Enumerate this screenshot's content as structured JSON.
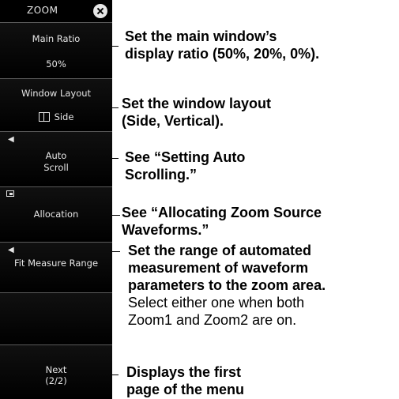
{
  "menu": {
    "title": "ZOOM",
    "main_ratio": {
      "label": "Main Ratio",
      "value": "50%"
    },
    "window_layout": {
      "label": "Window Layout",
      "value": "Side"
    },
    "auto_scroll": {
      "line1": "Auto",
      "line2": "Scroll"
    },
    "allocation": {
      "label": "Allocation"
    },
    "fit_measure": {
      "label": "Fit Measure Range"
    },
    "next": {
      "line1": "Next",
      "line2": "(2/2)"
    }
  },
  "annotations": {
    "main_ratio": [
      "Set the main window’s",
      "display ratio (50%, 20%, 0%)."
    ],
    "window_layout": [
      "Set the window layout",
      "(Side, Vertical)."
    ],
    "auto_scroll": [
      "See “Setting Auto",
      "Scrolling.”"
    ],
    "allocation": [
      "See “Allocating Zoom Source",
      "Waveforms.”"
    ],
    "fit_measure": [
      "Set the range of automated",
      "measurement of waveform",
      "parameters to the zoom area."
    ],
    "fit_measure_note": [
      "Select either one when both",
      "Zoom1 and Zoom2 are on."
    ],
    "next": [
      "Displays the first",
      "page of the menu"
    ]
  }
}
